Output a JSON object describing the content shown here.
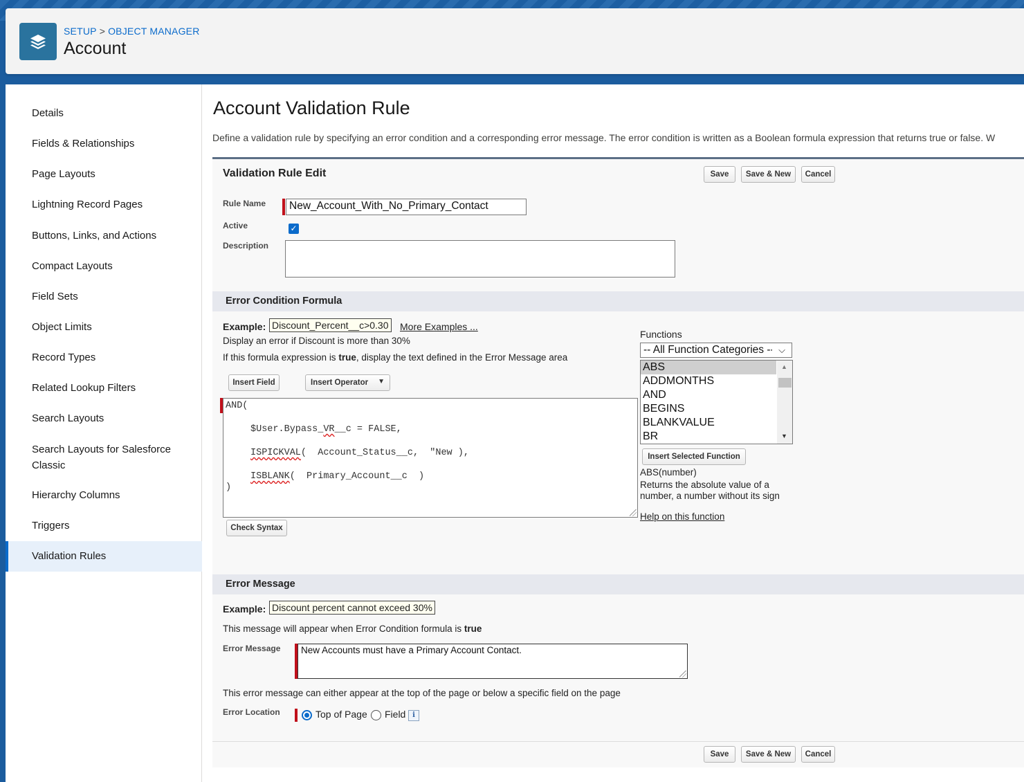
{
  "header": {
    "breadcrumb": [
      "SETUP",
      "OBJECT MANAGER"
    ],
    "breadcrumb_sep": ">",
    "title": "Account",
    "app_icon": "layers-icon"
  },
  "sidebar": {
    "items": [
      {
        "label": "Details"
      },
      {
        "label": "Fields & Relationships"
      },
      {
        "label": "Page Layouts"
      },
      {
        "label": "Lightning Record Pages"
      },
      {
        "label": "Buttons, Links, and Actions"
      },
      {
        "label": "Compact Layouts"
      },
      {
        "label": "Field Sets"
      },
      {
        "label": "Object Limits"
      },
      {
        "label": "Record Types"
      },
      {
        "label": "Related Lookup Filters"
      },
      {
        "label": "Search Layouts"
      },
      {
        "label": "Search Layouts for Salesforce",
        "label2": "Classic"
      },
      {
        "label": "Hierarchy Columns"
      },
      {
        "label": "Triggers"
      },
      {
        "label": "Validation Rules",
        "active": true
      }
    ]
  },
  "main": {
    "title": "Account Validation Rule",
    "intro": "Define a validation rule by specifying an error condition and a corresponding error message. The error condition is written as a Boolean formula expression that returns true or false. W",
    "form_title": "Validation Rule Edit",
    "buttons": {
      "save": "Save",
      "save_new": "Save & New",
      "cancel": "Cancel"
    },
    "rule_name_label": "Rule Name",
    "rule_name_value": "New_Account_With_No_Primary_Contact",
    "active_label": "Active",
    "active_checked": true,
    "description_label": "Description",
    "description_value": "",
    "error_condition": {
      "section_title": "Error Condition Formula",
      "example_label": "Example:",
      "example_value": "Discount_Percent__c>0.30",
      "more_examples": "More Examples ...",
      "example_desc": "Display an error if Discount is more than 30%",
      "if_text_pre": "If this formula expression is ",
      "if_text_bold": "true",
      "if_text_post": ", display the text defined in the Error Message area",
      "insert_field": "Insert Field",
      "insert_operator": "Insert Operator",
      "formula_lines": [
        "AND(",
        "$User.Bypass_VR__c = FALSE,",
        "ISPICKVAL(  Account_Status__c,  \"New ),",
        "ISBLANK(  Primary_Account__c  )",
        ")"
      ],
      "check_syntax": "Check Syntax",
      "functions_label": "Functions",
      "function_category": "-- All Function Categories --",
      "functions": [
        "ABS",
        "ADDMONTHS",
        "AND",
        "BEGINS",
        "BLANKVALUE",
        "BR"
      ],
      "selected_function": "ABS",
      "insert_selected_function": "Insert Selected Function",
      "function_signature": "ABS(number)",
      "function_desc_1": "Returns the absolute value of a",
      "function_desc_2": "number, a number without its sign",
      "help_link": "Help on this function"
    },
    "error_message": {
      "section_title": "Error Message",
      "example_label": "Example:",
      "example_value": "Discount percent cannot exceed 30%",
      "appear_text_pre": "This message will appear when Error Condition formula is ",
      "appear_text_bold": "true",
      "message_label": "Error Message",
      "message_value": "New Accounts must have a Primary Account Contact.",
      "location_desc": "This error message can either appear at the top of the page or below a specific field on the page",
      "location_label": "Error Location",
      "location_options": [
        "Top of Page",
        "Field"
      ],
      "location_selected": "Top of Page"
    }
  },
  "colors": {
    "accent": "#0b6bcb",
    "required": "#c0101b",
    "header_bg": "#1b5c9e",
    "app_icon_bg": "#2a739e"
  }
}
